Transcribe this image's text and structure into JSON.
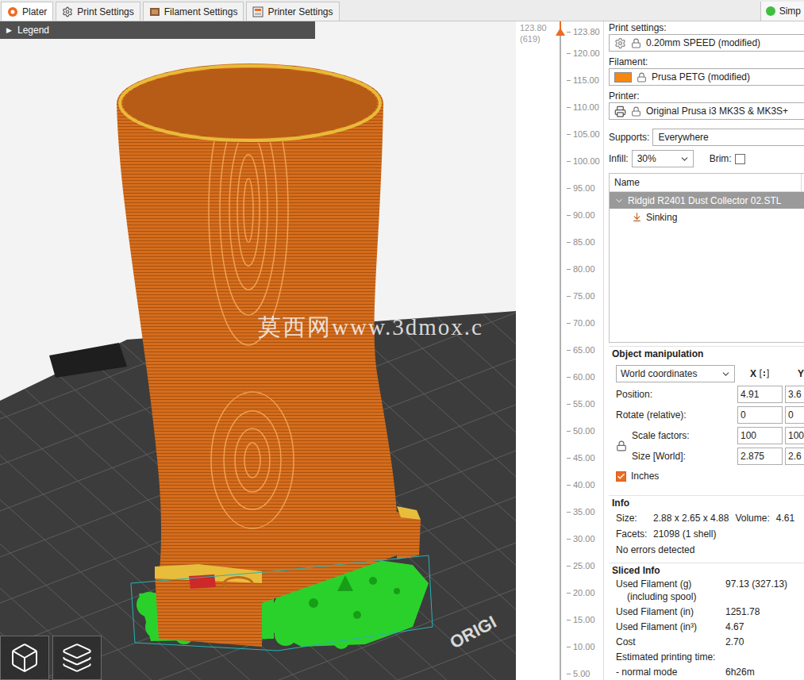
{
  "tabs": [
    {
      "label": "Plater",
      "selected": true
    },
    {
      "label": "Print Settings",
      "selected": false
    },
    {
      "label": "Filament Settings",
      "selected": false
    },
    {
      "label": "Printer Settings",
      "selected": false
    }
  ],
  "mode": {
    "label": "Simp",
    "color": "#3fbf3f"
  },
  "legend": {
    "arrow": "▶",
    "label": "Legend"
  },
  "viewport": {
    "watermark": "莫西网www.3dmox.c",
    "bed_label": "ORIGI"
  },
  "layer_slider": {
    "top_value": "123.80",
    "top_layer": "(619)",
    "level": 1,
    "ticks": [
      "123.80",
      "120.00",
      "115.00",
      "110.00",
      "105.00",
      "100.00",
      "95.00",
      "90.00",
      "85.00",
      "80.00",
      "75.00",
      "70.00",
      "65.00",
      "60.00",
      "55.00",
      "50.00",
      "45.00",
      "40.00",
      "35.00",
      "30.00",
      "25.00",
      "20.00",
      "15.00",
      "10.00",
      "5.00"
    ]
  },
  "presets": [
    {
      "kind": "print",
      "label": "Print settings:",
      "value": "0.20mm SPEED (modified)"
    },
    {
      "kind": "filament",
      "label": "Filament:",
      "value": "Prusa PETG (modified)",
      "color": "#f7870f"
    },
    {
      "kind": "printer",
      "label": "Printer:",
      "value": "Original Prusa i3 MK3S & MK3S+"
    }
  ],
  "supports": {
    "label": "Supports:",
    "value": "Everywhere"
  },
  "infill": {
    "label": "Infill:",
    "value": "30%"
  },
  "brim": {
    "label": "Brim:",
    "checked": false
  },
  "object_list": {
    "columns": [
      "Name"
    ],
    "rows": [
      {
        "name": "Ridgid R2401 Dust Collector 02.STL",
        "depth": 0,
        "expanded": true,
        "selected": true
      },
      {
        "name": "Sinking",
        "depth": 1,
        "selected": false
      }
    ]
  },
  "object_manipulation": {
    "title": "Object manipulation",
    "coordinates": "World coordinates",
    "axes": [
      "X",
      "Y"
    ],
    "rows": [
      {
        "label": "Position:",
        "values": [
          "4.91",
          "3.6"
        ],
        "locked": false
      },
      {
        "label": "Rotate (relative):",
        "values": [
          "0",
          "0"
        ],
        "locked": false
      },
      {
        "label": "Scale factors:",
        "values": [
          "100",
          "100"
        ],
        "locked": true
      },
      {
        "label": "Size [World]:",
        "values": [
          "2.875",
          "2.6"
        ],
        "locked": true
      }
    ],
    "inches": {
      "label": "Inches",
      "checked": true
    }
  },
  "info": {
    "title": "Info",
    "lines": [
      [
        {
          "label": "Size:",
          "value": "2.88 x 2.65 x 4.88"
        },
        {
          "label": "Volume:",
          "value": "4.61"
        }
      ],
      [
        {
          "label": "Facets:",
          "value": "21098 (1 shell)"
        }
      ]
    ],
    "status": "No errors detected"
  },
  "sliced_info": {
    "title": "Sliced Info",
    "rows": [
      {
        "label": "Used Filament (g)",
        "sublabel": "(including spool)",
        "value": "97.13 (327.13)"
      },
      {
        "label": "Used Filament (in)",
        "value": "1251.78"
      },
      {
        "label": "Used Filament (in³)",
        "value": "4.67"
      },
      {
        "label": "Cost",
        "value": "2.70"
      },
      {
        "label": "Estimated printing time:"
      },
      {
        "label": "- normal mode",
        "value": "6h26m"
      }
    ]
  }
}
